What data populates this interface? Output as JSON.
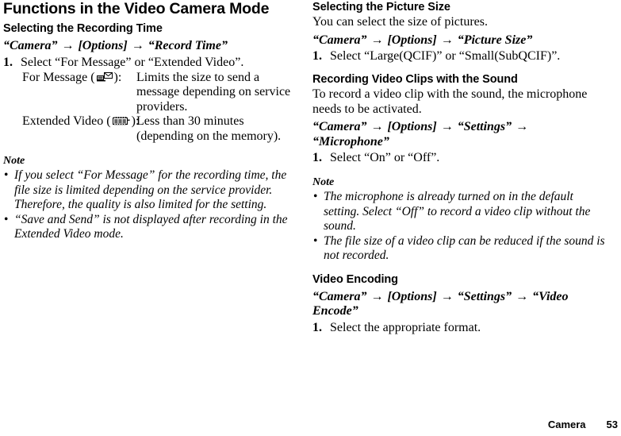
{
  "document": {
    "title": "Functions in the Video Camera Mode"
  },
  "left_column": {
    "recording_time": {
      "heading": "Selecting the Recording Time",
      "path": {
        "part1": "“Camera”",
        "arrow1": "→",
        "part2": "[Options]",
        "arrow2": "→",
        "part3": "“Record Time”"
      },
      "step": {
        "number": "1.",
        "text": "Select “For Message” or “Extended Video”."
      },
      "definitions": [
        {
          "term_prefix": "For Message (",
          "icon": "video-message-icon",
          "term_suffix": "):",
          "description": "Limits the size to send a message depending on service providers."
        },
        {
          "term_prefix": "Extended Video (",
          "icon": "film-strip-icon",
          "term_suffix": "):",
          "description": "Less than 30 minutes (depending on the memory)."
        }
      ],
      "note": {
        "title": "Note",
        "items": [
          "If you select “For Message” for the recording time, the file size is limited depending on the service provider. Therefore, the quality is also limited for the setting.",
          "“Save and Send” is not displayed after recording in the Extended Video mode."
        ]
      }
    }
  },
  "right_column": {
    "picture_size": {
      "heading": "Selecting the Picture Size",
      "intro": "You can select the size of pictures.",
      "path": {
        "part1": "“Camera”",
        "arrow1": "→",
        "part2": "[Options]",
        "arrow2": "→",
        "part3": "“Picture Size”"
      },
      "step": {
        "number": "1.",
        "text": "Select “Large(QCIF)” or “Small(SubQCIF)”."
      }
    },
    "recording_sound": {
      "heading": "Recording Video Clips with the Sound",
      "intro": "To record a video clip with the sound, the microphone needs to be activated.",
      "path": {
        "part1": "“Camera”",
        "arrow1": "→",
        "part2": "[Options]",
        "arrow2": "→",
        "part3": "“Settings”",
        "arrow3": "→",
        "part4": "“Microphone”"
      },
      "step": {
        "number": "1.",
        "text": "Select “On” or “Off”."
      },
      "note": {
        "title": "Note",
        "items": [
          "The microphone is already turned on in the default setting. Select “Off” to record a video clip without the sound.",
          "The file size of a video clip can be reduced if the sound is not recorded."
        ]
      }
    },
    "video_encoding": {
      "heading": "Video Encoding",
      "path": {
        "part1": "“Camera”",
        "arrow1": "→",
        "part2": "[Options]",
        "arrow2": "→",
        "part3": "“Settings”",
        "arrow3": "→",
        "part4": "“Video Encode”"
      },
      "step": {
        "number": "1.",
        "text": "Select the appropriate format."
      }
    }
  },
  "footer": {
    "chapter": "Camera",
    "page_number": "53"
  }
}
